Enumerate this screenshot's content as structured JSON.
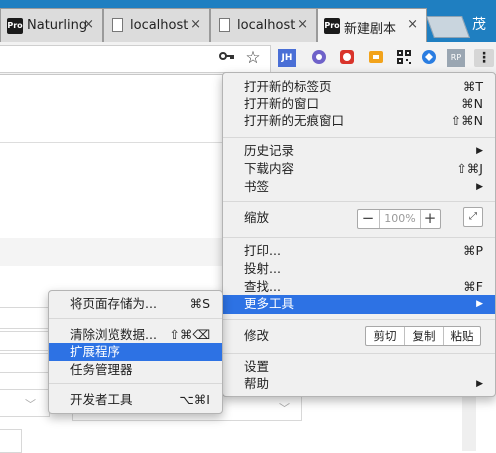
{
  "tabs": [
    {
      "icon": "pro-icon",
      "icon_text": "Pro",
      "title": "Naturling",
      "close": "×"
    },
    {
      "icon": "document-icon",
      "title": "localhost",
      "close": "×"
    },
    {
      "icon": "document-icon",
      "title": "localhost",
      "close": "×"
    },
    {
      "icon": "pro-icon",
      "icon_text": "Pro",
      "title": "新建剧本",
      "close": "×"
    }
  ],
  "profile_name": "茂",
  "toolbar": {
    "key_icon": "key-icon",
    "star_icon": "star-icon",
    "extensions": [
      {
        "name": "jh-extension-icon",
        "text": "JH",
        "color": "#4a6fd6"
      },
      {
        "name": "extension-2-icon",
        "color": "#6f62c9"
      },
      {
        "name": "extension-3-icon",
        "color": "#d9342b"
      },
      {
        "name": "extension-4-icon",
        "color": "#f2a31b"
      },
      {
        "name": "qr-code-icon",
        "color": "#222222"
      },
      {
        "name": "extension-6-icon",
        "color": "#2a7de1"
      },
      {
        "name": "rp-extension-icon",
        "text": "RP",
        "color": "#9aa6b2"
      }
    ],
    "menu_icon": "kebab-menu-icon"
  },
  "main_menu": {
    "group1": [
      {
        "label": "打开新的标签页",
        "shortcut": "⌘T"
      },
      {
        "label": "打开新的窗口",
        "shortcut": "⌘N"
      },
      {
        "label": "打开新的无痕窗口",
        "shortcut": "⇧⌘N"
      }
    ],
    "group2": [
      {
        "label": "历史记录",
        "shortcut": "▶"
      },
      {
        "label": "下载内容",
        "shortcut": "⇧⌘J"
      },
      {
        "label": "书签",
        "shortcut": "▶"
      }
    ],
    "zoom": {
      "label": "缩放",
      "minus": "−",
      "value": "100%",
      "plus": "+",
      "fullscreen": "⤢"
    },
    "group3": [
      {
        "label": "打印...",
        "shortcut": "⌘P"
      },
      {
        "label": "投射...",
        "shortcut": ""
      },
      {
        "label": "查找...",
        "shortcut": "⌘F"
      },
      {
        "label": "更多工具",
        "shortcut": "▶"
      }
    ],
    "edit": {
      "label": "修改",
      "cut": "剪切",
      "copy": "复制",
      "paste": "粘贴"
    },
    "group4": [
      {
        "label": "设置",
        "shortcut": ""
      },
      {
        "label": "帮助",
        "shortcut": "▶"
      }
    ]
  },
  "more_tools_menu": {
    "group1": [
      {
        "label": "将页面存储为...",
        "shortcut": "⌘S"
      }
    ],
    "group2": [
      {
        "label": "清除浏览数据...",
        "shortcut": "⇧⌘⌫"
      },
      {
        "label": "扩展程序",
        "shortcut": ""
      },
      {
        "label": "任务管理器",
        "shortcut": ""
      }
    ],
    "group3": [
      {
        "label": "开发者工具",
        "shortcut": "⌥⌘I"
      }
    ]
  },
  "colors": {
    "tabstrip": "#1f7fc1",
    "highlight": "#2d72e4",
    "menu_bg": "#f0f0f0"
  }
}
